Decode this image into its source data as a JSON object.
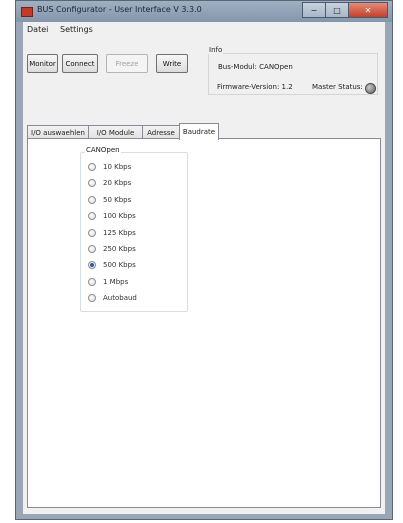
{
  "window": {
    "title": "BUS Configurator - User Interface  V 3.3.0",
    "minimize": "−",
    "maximize": "□",
    "close": "✕"
  },
  "menu": [
    "Datei",
    "Settings"
  ],
  "toolbar": {
    "monitor": "Monitor",
    "connect": "Connect",
    "freeze": "Freeze",
    "write": "Write"
  },
  "info": {
    "title": "Info",
    "bus_modul": "Bus-Modul: CANOpen",
    "firmware": "Firmware-Version:  1.2",
    "master_status": "Master Status:"
  },
  "tabs": [
    "I/O auswaehlen",
    "I/O Module",
    "Adresse",
    "Baudrate"
  ],
  "active_tab": "Baudrate",
  "baudrate_group": {
    "title": "CANOpen",
    "options": [
      "10 Kbps",
      "20 Kbps",
      "50 Kbps",
      "100 Kbps",
      "125 Kbps",
      "250 Kbps",
      "500 Kbps",
      "1 Mbps",
      "Autobaud"
    ],
    "selected": "500 Kbps"
  },
  "colors": {
    "titlebar": "#8fa0b5",
    "radio_selected": "#2c5aa0",
    "status_led": "#7a7a7a"
  }
}
